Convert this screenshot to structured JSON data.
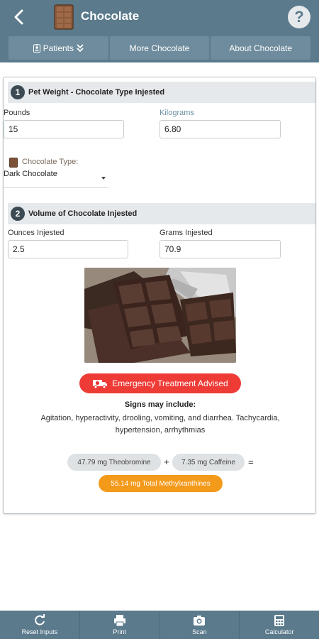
{
  "app": {
    "title": "Chocolate",
    "icons": {
      "back": "chevron-left-icon",
      "logo": "chocolate-bar-icon",
      "help": "question-mark-icon"
    },
    "help_label": "?"
  },
  "tabs": [
    {
      "label": "Patients",
      "icon": "id-badge-icon",
      "trailing_icon": "double-chevron-down-icon"
    },
    {
      "label": "More Chocolate"
    },
    {
      "label": "About Chocolate"
    }
  ],
  "section1": {
    "number": "1",
    "title": "Pet Weight - Chocolate Type Injested",
    "pounds_label": "Pounds",
    "pounds_value": "15",
    "kilograms_label": "Kilograms",
    "kilograms_value": "6.80",
    "chocolate_type_label": "Chocolate Type:",
    "chocolate_type_value": "Dark Chocolate"
  },
  "section2": {
    "number": "2",
    "title": "Volume of Chocolate Injested",
    "ounces_label": "Ounces Injested",
    "ounces_value": "2.5",
    "grams_label": "Grams Injested",
    "grams_value": "70.9"
  },
  "result": {
    "alert_label": "Emergency Treatment Advised",
    "alert_icon": "ambulance-icon",
    "signs_title": "Signs may include:",
    "signs_text": "Agitation, hyperactivity, drooling, vomiting, and diarrhea. Tachycardia, hypertension, arrhythmias",
    "theobromine": "47.79 mg Theobromine",
    "plus": "+",
    "caffeine": "7.35 mg Caffeine",
    "equals": "=",
    "total": "55.14 mg Total Methylxanthines"
  },
  "colors": {
    "primary": "#5b7a8c",
    "alert": "#ee3b36",
    "total": "#f39a1b"
  },
  "bottom_bar": [
    {
      "label": "Reset Inputs",
      "icon": "refresh-icon"
    },
    {
      "label": "Print",
      "icon": "printer-icon"
    },
    {
      "label": "Scan",
      "icon": "camera-icon"
    },
    {
      "label": "Calculator",
      "icon": "calculator-icon"
    }
  ]
}
